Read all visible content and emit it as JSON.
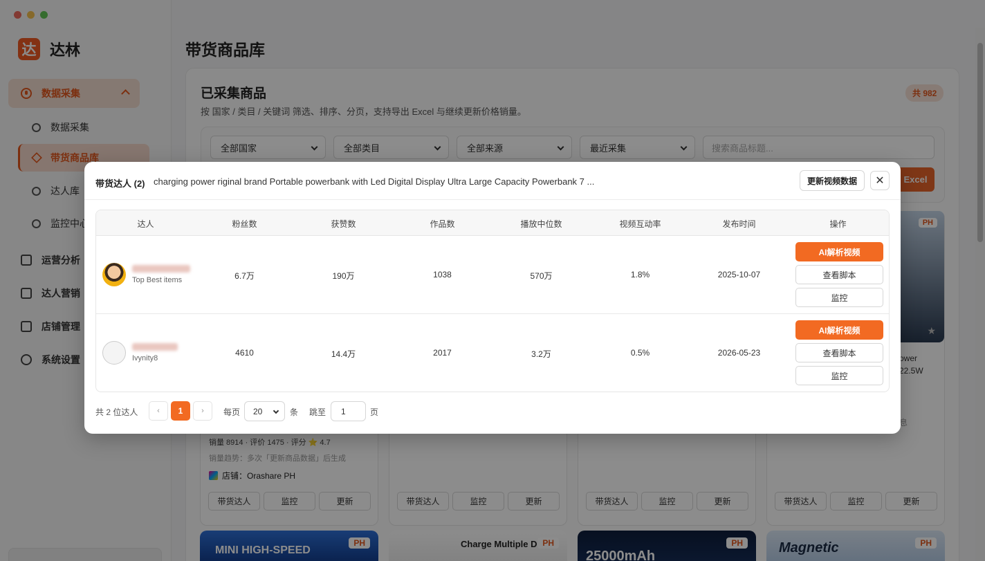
{
  "colors": {
    "accent": "#f26a22",
    "accent_soft": "#f4d8cb",
    "window_red": "#ed6a5e",
    "window_yellow": "#f5bf4f",
    "window_green": "#61c554"
  },
  "brand": {
    "logo_char": "达",
    "name": "达林"
  },
  "sidebar": {
    "group_label": "数据采集",
    "sub_items": [
      "数据采集",
      "带货商品库",
      "达人库",
      "监控中心"
    ],
    "main_items": [
      "运营分析",
      "达人营销",
      "店铺管理",
      "系统设置"
    ]
  },
  "page": {
    "title": "带货商品库"
  },
  "panel": {
    "title": "已采集商品",
    "subtitle": "按 国家 / 类目 / 关键词 筛选、排序、分页，支持导出 Excel 与继续更新价格销量。",
    "total": "共 982"
  },
  "filters": {
    "country": "全部国家",
    "category": "全部类目",
    "source": "全部来源",
    "sort": "最近采集",
    "search_placeholder": "搜索商品标题...",
    "export_label": "Excel"
  },
  "product_card": {
    "meta": "销量 8914 · 评价 1475 · 评分 ⭐ 4.7",
    "trend": "销量趋势：多次「更新商品数据」后生成",
    "store": "店铺：Orashare PH",
    "buttons": [
      "带货达人",
      "监控",
      "更新"
    ]
  },
  "thumbs": [
    {
      "text": "MINI HIGH-SPEED",
      "badge": "PH"
    },
    {
      "text": "Charge Multiple Dev",
      "badge": "PH"
    },
    {
      "text": "25000mAh",
      "badge": "PH"
    },
    {
      "text": "Magnetic",
      "badge": "PH"
    }
  ],
  "right_card": {
    "badge": "PH",
    "partial_line1": "ower",
    "partial_line2": "22.5W",
    "partial_line3": "息"
  },
  "modal": {
    "title": "带货达人 (2)",
    "description": "charging power  riginal brand Portable powerbank with Led Digital Display Ultra Large Capacity Powerbank 7 ...",
    "refresh_label": "更新视频数据",
    "close_symbol": "✕",
    "columns": [
      "达人",
      "粉丝数",
      "获赞数",
      "作品数",
      "播放中位数",
      "视频互动率",
      "发布时间",
      "操作"
    ],
    "rows": [
      {
        "handle": "Top Best items",
        "followers": "6.7万",
        "likes": "190万",
        "videos": "1038",
        "median_views": "570万",
        "engagement": "1.8%",
        "date": "2025-10-07"
      },
      {
        "handle": "Ivynity8",
        "followers": "4610",
        "likes": "14.4万",
        "videos": "2017",
        "median_views": "3.2万",
        "engagement": "0.5%",
        "date": "2026-05-23"
      }
    ],
    "actions": {
      "ai": "AI解析视频",
      "script": "查看脚本",
      "monitor": "监控"
    },
    "pager": {
      "total": "共 2 位达人",
      "prev": "‹",
      "current": "1",
      "next": "›",
      "per_page_label": "每页",
      "per_page": "20",
      "unit": "条",
      "jump_label": "跳至",
      "jump_value": "1",
      "page_unit": "页"
    }
  }
}
